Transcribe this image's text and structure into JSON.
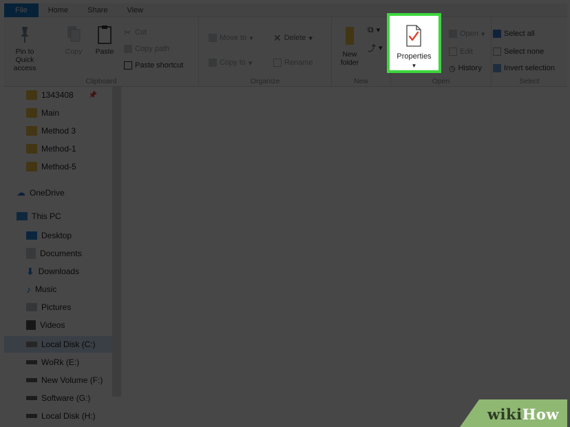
{
  "tabs": [
    "File",
    "Home",
    "Share",
    "View"
  ],
  "ribbon": {
    "clipboard": {
      "label": "Clipboard",
      "pin": "Pin to Quick access",
      "copy": "Copy",
      "paste": "Paste",
      "cut": "Cut",
      "copy_path": "Copy path",
      "paste_shortcut": "Paste shortcut"
    },
    "organize": {
      "label": "Organize",
      "move_to": "Move to",
      "copy_to": "Copy to",
      "delete": "Delete",
      "rename": "Rename"
    },
    "new": {
      "label": "New",
      "new_folder": "New folder"
    },
    "open": {
      "label": "Open",
      "properties": "Properties",
      "open": "Open",
      "edit": "Edit",
      "history": "History"
    },
    "select": {
      "label": "Select",
      "select_all": "Select all",
      "select_none": "Select none",
      "invert": "Invert selection"
    }
  },
  "nav": {
    "quick": [
      "1343408",
      "Main",
      "Method 3",
      "Method-1",
      "Method-5"
    ],
    "onedrive": "OneDrive",
    "this_pc": "This PC",
    "pc_items": [
      "Desktop",
      "Documents",
      "Downloads",
      "Music",
      "Pictures",
      "Videos"
    ],
    "drives": [
      "Local Disk (C:)",
      "WoRk (E:)",
      "New Volume (F:)",
      "Software (G:)",
      "Local Disk (H:)"
    ]
  },
  "watermark": {
    "wiki": "wiki",
    "how": "How"
  },
  "colors": {
    "file_tab": "#1979ca",
    "highlight": "#3dd63d",
    "folder": "#f0c34b",
    "watermark": "#8fb873"
  }
}
